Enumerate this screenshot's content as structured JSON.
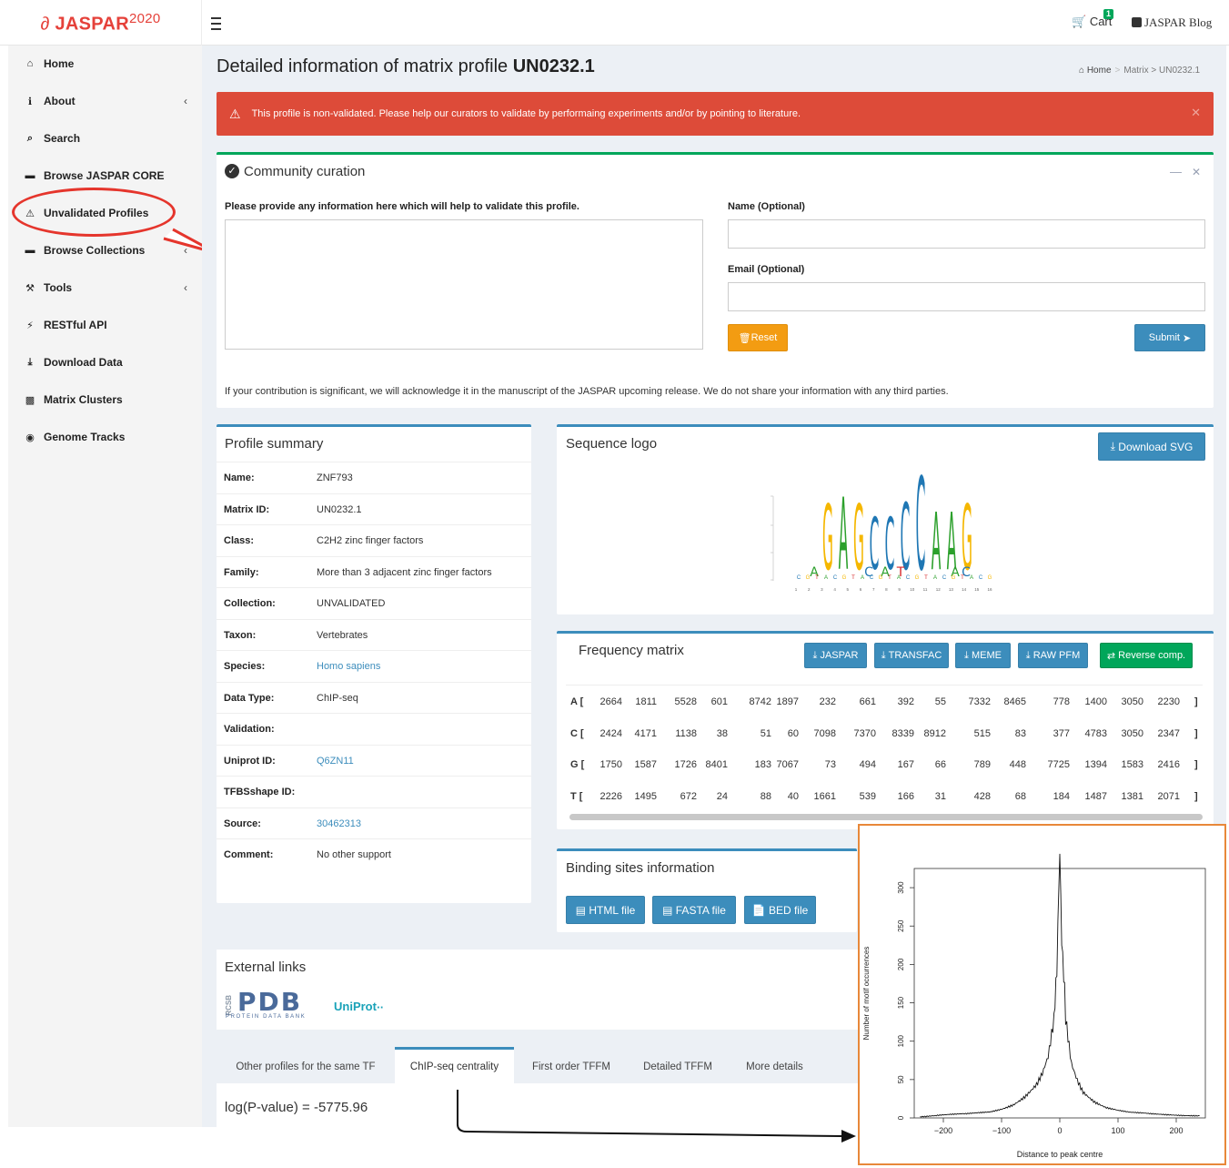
{
  "brand": {
    "logo": "JASPAR",
    "year": "2020"
  },
  "topnav": {
    "cart_label": "Cart",
    "cart_count": "1",
    "blog_label": "JASPAR Blog"
  },
  "sidebar": {
    "items": [
      {
        "label": "Home",
        "icon": "home-icon",
        "chevron": false
      },
      {
        "label": "About",
        "icon": "info-icon",
        "chevron": true
      },
      {
        "label": "Search",
        "icon": "search-icon",
        "chevron": false
      },
      {
        "label": "Browse JASPAR CORE",
        "icon": "folder-icon",
        "chevron": false
      },
      {
        "label": "Unvalidated Profiles",
        "icon": "warning-icon",
        "chevron": false
      },
      {
        "label": "Browse Collections",
        "icon": "folder-icon",
        "chevron": true
      },
      {
        "label": "Tools",
        "icon": "wrench-icon",
        "chevron": true
      },
      {
        "label": "RESTful API",
        "icon": "plug-icon",
        "chevron": false
      },
      {
        "label": "Download Data",
        "icon": "download-icon",
        "chevron": false
      },
      {
        "label": "Matrix Clusters",
        "icon": "cluster-icon",
        "chevron": false
      },
      {
        "label": "Genome Tracks",
        "icon": "map-marker-icon",
        "chevron": false
      }
    ]
  },
  "page": {
    "title_prefix": "Detailed information of matrix profile ",
    "title_id": "UN0232.1"
  },
  "breadcrumb": {
    "home": "Home",
    "matrix": "Matrix",
    "current": "UN0232.1"
  },
  "alert": {
    "text": "This profile is non-validated. Please help our curators to validate by performaing experiments and/or by pointing to literature."
  },
  "curation": {
    "title": "Community curation",
    "info_label": "Please provide any information here which will help to validate this profile.",
    "name_label": "Name (Optional)",
    "email_label": "Email (Optional)",
    "reset": "Reset",
    "submit": "Submit",
    "note": "If your contribution is significant, we will acknowledge it in the manuscript of the JASPAR upcoming release. We do not share your information with any third parties."
  },
  "summary": {
    "title": "Profile summary",
    "rows": [
      {
        "key": "Name:",
        "value": "ZNF793",
        "link": false
      },
      {
        "key": "Matrix ID:",
        "value": "UN0232.1",
        "link": false
      },
      {
        "key": "Class:",
        "value": "C2H2 zinc finger factors",
        "link": false
      },
      {
        "key": "Family:",
        "value": "More than 3 adjacent zinc finger factors",
        "link": false
      },
      {
        "key": "Collection:",
        "value": "UNVALIDATED",
        "link": false
      },
      {
        "key": "Taxon:",
        "value": "Vertebrates",
        "link": false
      },
      {
        "key": "Species:",
        "value": "Homo sapiens",
        "link": true
      },
      {
        "key": "Data Type:",
        "value": "ChIP-seq",
        "link": false
      },
      {
        "key": "Validation:",
        "value": "",
        "link": false
      },
      {
        "key": "Uniprot ID:",
        "value": "Q6ZN11",
        "link": true
      },
      {
        "key": "TFBSshape ID:",
        "value": "",
        "link": false
      },
      {
        "key": "Source:",
        "value": "30462313",
        "link": true
      },
      {
        "key": "Comment:",
        "value": "No other support",
        "link": false
      }
    ]
  },
  "logo_panel": {
    "title": "Sequence logo",
    "download": "Download SVG",
    "main_letters": [
      "G",
      "A",
      "G",
      "C",
      "C",
      "C",
      "C",
      "A",
      "A",
      "G"
    ],
    "letter_colors": {
      "A": "#2ca02c",
      "C": "#1f77b4",
      "G": "#f5b700",
      "T": "#d62728"
    },
    "positions": [
      "1",
      "2",
      "3",
      "4",
      "5",
      "6",
      "7",
      "8",
      "9",
      "10",
      "11",
      "12",
      "13",
      "14",
      "15",
      "16"
    ]
  },
  "freq": {
    "title": "Frequency matrix",
    "buttons": [
      "JASPAR",
      "TRANSFAC",
      "MEME",
      "RAW PFM"
    ],
    "reverse": "Reverse comp.",
    "rows": [
      {
        "nuc": "A",
        "values": [
          "2664",
          "1811",
          "5528",
          "601",
          "8742",
          "1897",
          "232",
          "661",
          "392",
          "55",
          "7332",
          "8465",
          "778",
          "1400",
          "3050",
          "2230"
        ]
      },
      {
        "nuc": "C",
        "values": [
          "2424",
          "4171",
          "1138",
          "38",
          "51",
          "60",
          "7098",
          "7370",
          "8339",
          "8912",
          "515",
          "83",
          "377",
          "4783",
          "3050",
          "2347"
        ]
      },
      {
        "nuc": "G",
        "values": [
          "1750",
          "1587",
          "1726",
          "8401",
          "183",
          "7067",
          "73",
          "494",
          "167",
          "66",
          "789",
          "448",
          "7725",
          "1394",
          "1583",
          "2416"
        ]
      },
      {
        "nuc": "T",
        "values": [
          "2226",
          "1495",
          "672",
          "24",
          "88",
          "40",
          "1661",
          "539",
          "166",
          "31",
          "428",
          "68",
          "184",
          "1487",
          "1381",
          "2071"
        ]
      }
    ]
  },
  "binding": {
    "title": "Binding sites information",
    "html": "HTML file",
    "fasta": "FASTA file",
    "bed": "BED file"
  },
  "external": {
    "title": "External links",
    "pdb": "PDB",
    "pdb_sub": "PROTEIN DATA BANK",
    "pdb_side": "RCSB",
    "uniprot": "UniProt"
  },
  "tabs": [
    "Other profiles for the same TF",
    "ChIP-seq centrality",
    "First order TFFM",
    "Detailed TFFM",
    "More details"
  ],
  "centrality": {
    "text": "log(P-value) = -5775.96"
  },
  "chart_data": {
    "type": "line",
    "title": "",
    "xlabel": "Distance to peak centre",
    "ylabel": "Number of motif occurrences",
    "xlim": [
      -250,
      250
    ],
    "ylim": [
      0,
      325
    ],
    "xticks": [
      -200,
      -100,
      0,
      100,
      200
    ],
    "yticks": [
      0,
      50,
      100,
      150,
      200,
      250,
      300
    ],
    "x": [
      -240,
      -200,
      -160,
      -120,
      -100,
      -80,
      -60,
      -40,
      -30,
      -20,
      -10,
      -5,
      0,
      5,
      10,
      20,
      30,
      40,
      60,
      80,
      100,
      120,
      160,
      200,
      240
    ],
    "y": [
      2,
      4,
      5,
      8,
      12,
      18,
      28,
      42,
      55,
      75,
      120,
      210,
      325,
      215,
      125,
      70,
      50,
      35,
      22,
      14,
      10,
      7,
      5,
      4,
      3
    ]
  }
}
